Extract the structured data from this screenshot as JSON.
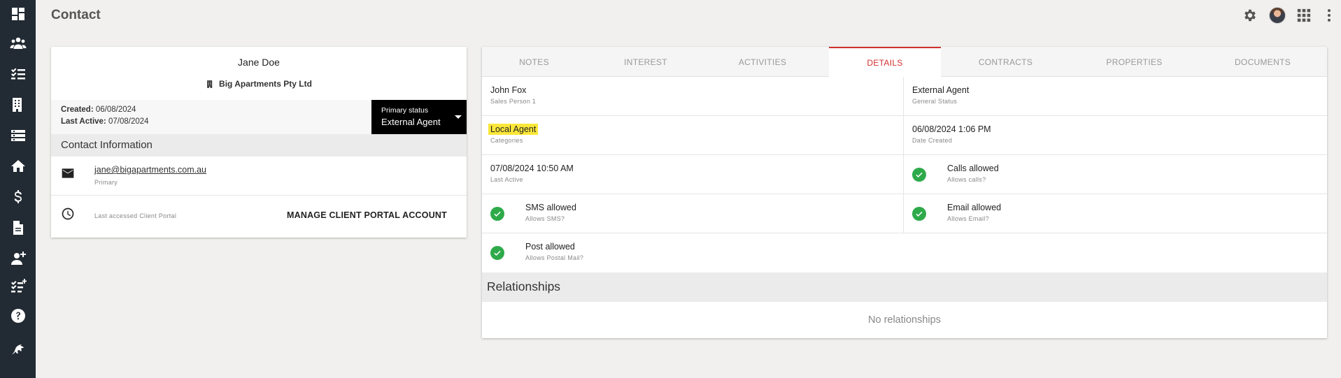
{
  "header": {
    "title": "Contact"
  },
  "sidebar": {
    "items": [
      {
        "icon": "dashboard-icon",
        "name": "Dashboard"
      },
      {
        "icon": "people-icon",
        "name": "Contacts"
      },
      {
        "icon": "tasks-icon",
        "name": "Tasks"
      },
      {
        "icon": "building-icon",
        "name": "Companies"
      },
      {
        "icon": "list-icon",
        "name": "Lists"
      },
      {
        "icon": "home-icon",
        "name": "Properties"
      },
      {
        "icon": "dollar-icon",
        "name": "Finance"
      },
      {
        "icon": "document-icon",
        "name": "Documents"
      },
      {
        "icon": "add-person-icon",
        "name": "Add contact"
      },
      {
        "icon": "add-task-icon",
        "name": "Add task"
      },
      {
        "icon": "help-icon",
        "name": "Help"
      },
      {
        "icon": "logo-icon",
        "name": "Logo"
      }
    ]
  },
  "contact": {
    "name": "Jane Doe",
    "company": "Big Apartments Pty Ltd",
    "created_label": "Created:",
    "created": "06/08/2024",
    "last_active_label": "Last Active:",
    "last_active": "07/08/2024",
    "status_label": "Primary status",
    "status_value": "External Agent",
    "contact_info_title": "Contact Information",
    "email": "jane@bigapartments.com.au",
    "email_label": "Primary",
    "portal_label": "Last accessed Client Portal",
    "portal_button": "MANAGE CLIENT PORTAL ACCOUNT"
  },
  "tabs": [
    "NOTES",
    "INTEREST",
    "ACTIVITIES",
    "DETAILS",
    "CONTRACTS",
    "PROPERTIES",
    "DOCUMENTS"
  ],
  "active_tab": "DETAILS",
  "details": {
    "sales_person": {
      "value": "John Fox",
      "label": "Sales Person 1"
    },
    "general_status": {
      "value": "External Agent",
      "label": "General Status"
    },
    "categories": {
      "value": "Local Agent",
      "label": "Categories"
    },
    "date_created": {
      "value": "06/08/2024 1:06 PM",
      "label": "Date Created"
    },
    "last_active": {
      "value": "07/08/2024 10:50 AM",
      "label": "Last Active"
    },
    "calls": {
      "value": "Calls allowed",
      "label": "Allows calls?"
    },
    "sms": {
      "value": "SMS allowed",
      "label": "Allows SMS?"
    },
    "email": {
      "value": "Email allowed",
      "label": "Allows Email?"
    },
    "post": {
      "value": "Post allowed",
      "label": "Allows Postal Mail?"
    }
  },
  "relationships": {
    "title": "Relationships",
    "empty": "No relationships"
  },
  "colors": {
    "sidebar": "#222a33",
    "accent": "#d32f2f",
    "check": "#2eaa4a",
    "highlight": "#fbe73a"
  }
}
